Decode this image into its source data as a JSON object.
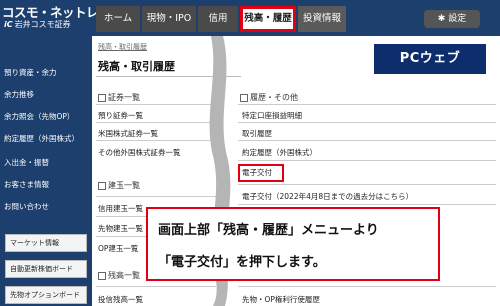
{
  "logo": {
    "main": "コスモ・ネットレ",
    "sub_mark": "iC",
    "sub": "岩井コスモ証券"
  },
  "tabs": [
    {
      "label": "ホーム"
    },
    {
      "label": "現物・IPO"
    },
    {
      "label": "信用"
    },
    {
      "label": "残高・履歴"
    },
    {
      "label": "投資情報"
    }
  ],
  "settings": {
    "label": "設定",
    "icon": "gear-icon"
  },
  "sidebar": {
    "items": [
      {
        "label": "預り資産・余力"
      },
      {
        "label": "余力推移"
      },
      {
        "label": "余力照会（先物OP）"
      },
      {
        "label": "約定履歴（外国株式）"
      },
      {
        "label": "入出金・振替"
      },
      {
        "label": "お客さま情報"
      },
      {
        "label": "お問い合わせ"
      }
    ],
    "buttons": [
      {
        "label": "マーケット情報"
      },
      {
        "label": "自動更新株価ボード"
      },
      {
        "label": "先物オプションボード"
      }
    ]
  },
  "main": {
    "breadcrumb": "残高・取引履歴",
    "title": "残高・取引履歴",
    "badge": "PCウェブ",
    "left_col": {
      "section1": "証券一覧",
      "links1": [
        "預り証券一覧",
        "米国株式証券一覧",
        "その他外国株式証券一覧"
      ],
      "section2": "建玉一覧",
      "links2": [
        "信用建玉一覧",
        "先物建玉一覧",
        "OP建玉一覧"
      ],
      "section3": "残高一覧",
      "links3": [
        "投信残高一覧"
      ]
    },
    "right_col": {
      "section1": "履歴・その他",
      "links1": [
        "特定口座損益明細",
        "取引履歴",
        "約定履歴（外国株式）",
        "電子交付",
        "電子交付（2022年4月8日までの過去分はこちら）"
      ],
      "link_bottom": "先物・OP権利行使履歴"
    }
  },
  "callout": {
    "line1": "画面上部「残高・履歴」メニューより",
    "line2": "「電子交付」を押下します。"
  }
}
